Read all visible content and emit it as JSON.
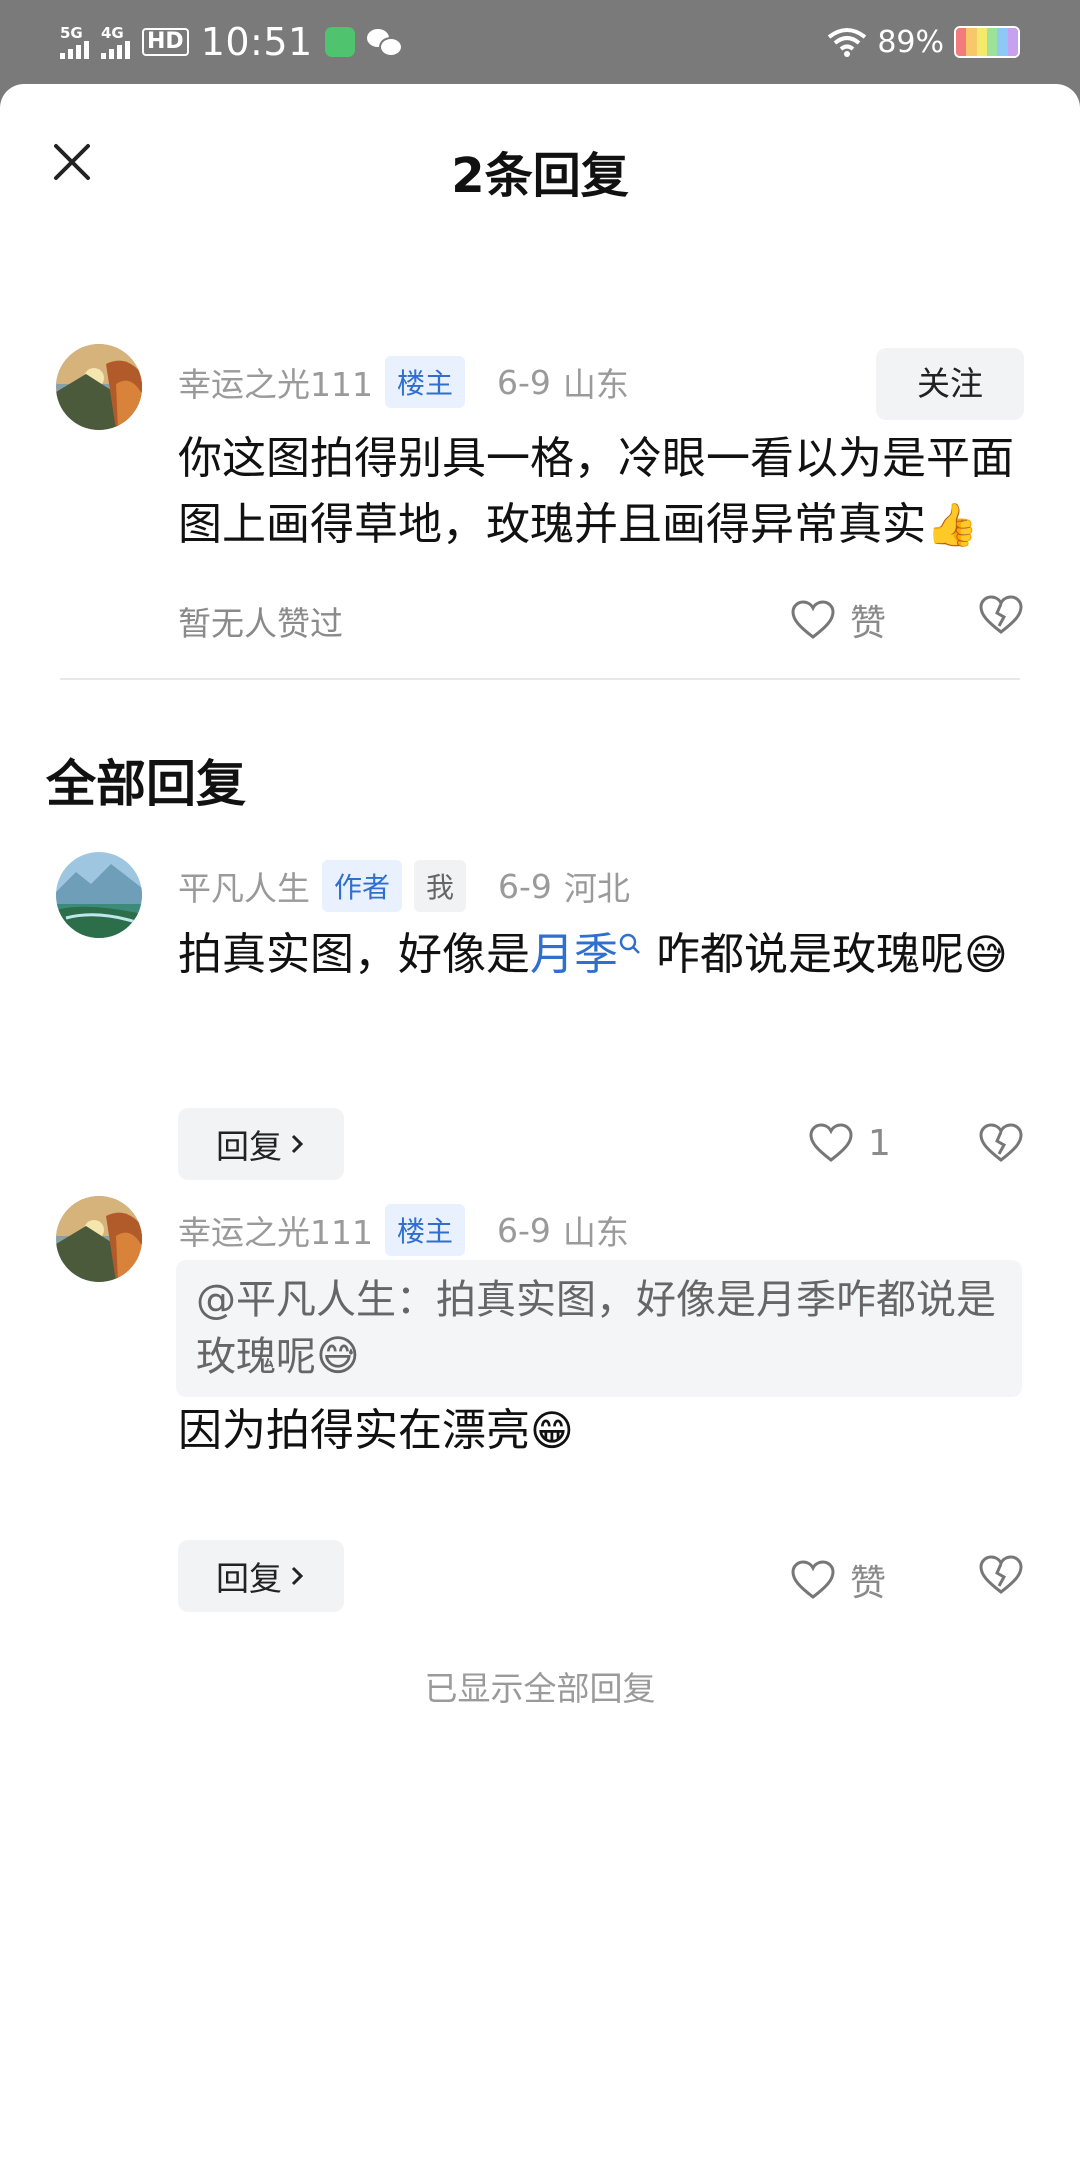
{
  "status_bar": {
    "network1": "5G",
    "network2": "4G",
    "hd": "HD",
    "time": "10:51",
    "battery_pct": "89%",
    "battery_colors": [
      "#f47b7b",
      "#f7c86a",
      "#f4e96b",
      "#9be39a",
      "#8ec9f5",
      "#c7a0f0"
    ]
  },
  "header": {
    "title": "2条回复",
    "close_icon": "close-icon"
  },
  "main_comment": {
    "username": "幸运之光111",
    "badge": "楼主",
    "date": "6-9",
    "location": "山东",
    "follow_label": "关注",
    "content": "你这图拍得别具一格，冷眼一看以为是平面图上画得草地，玫瑰并且画得异常真实",
    "emoji": "👍",
    "no_likes": "暂无人赞过",
    "like_label": "赞",
    "like_icon": "heart-icon",
    "dislike_icon": "broken-heart-icon"
  },
  "section_title": "全部回复",
  "replies": [
    {
      "username": "平凡人生",
      "badge": "作者",
      "badge2": "我",
      "date": "6-9",
      "location": "河北",
      "content_before": "拍真实图，好像是",
      "content_link": "月季",
      "content_after": "咋都说是玫瑰呢",
      "emoji": "😅",
      "reply_label": "回复",
      "like_count": "1"
    },
    {
      "username": "幸运之光111",
      "badge": "楼主",
      "date": "6-9",
      "location": "山东",
      "quote": "@平凡人生：拍真实图，好像是月季咋都说是玫瑰呢",
      "quote_emoji": "😅",
      "content": "因为拍得实在漂亮",
      "emoji": "😁",
      "reply_label": "回复",
      "like_label": "赞"
    }
  ],
  "end_text": "已显示全部回复"
}
